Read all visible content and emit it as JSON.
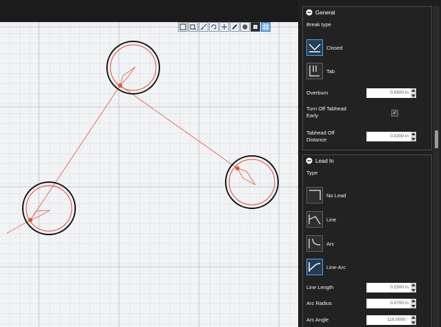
{
  "canvas": {
    "grid_color": "#cdd3d9",
    "minor_grid_color": "#e6e9ed",
    "background": "#f2f3f4",
    "path_color": "#e35a4a",
    "marker_color": "#d9572a",
    "circle_outer_color": "#111111",
    "circle_inner_color": "#e0473b",
    "toolbar_icons": [
      "zoom-fit-icon",
      "zoom-window-icon",
      "measure-icon",
      "rotate-view-icon",
      "move-view-icon",
      "draw-icon",
      "shade-icon",
      "square-icon",
      "grid-icon"
    ]
  },
  "panel": {
    "general": {
      "title": "General",
      "break_type_label": "Break type",
      "options": [
        {
          "label": "Closed",
          "icon": "closed-break-icon",
          "selected": true
        },
        {
          "label": "Tab",
          "icon": "tab-break-icon",
          "selected": false
        }
      ],
      "overburn": {
        "label": "Overburn",
        "value": "0.0500 in"
      },
      "turn_off": {
        "label_line1": "Turn Off Tabhead",
        "label_line2": "Early",
        "checked": true,
        "check_glyph": "✓"
      },
      "tabhead_off": {
        "label_line1": "Tabhead Off",
        "label_line2": "Distance",
        "value": "0.0200 in"
      }
    },
    "leadin": {
      "title": "Lead In",
      "type_label": "Type",
      "options": [
        {
          "label": "No Lead",
          "icon": "no-lead-icon",
          "selected": false
        },
        {
          "label": "Line",
          "icon": "line-lead-icon",
          "selected": false
        },
        {
          "label": "Arc",
          "icon": "arc-lead-icon",
          "selected": false
        },
        {
          "label": "Line-Arc",
          "icon": "line-arc-lead-icon",
          "selected": true
        }
      ],
      "line_length": {
        "label": "Line Length",
        "value": "0.1500 in"
      },
      "arc_radius": {
        "label": "Arc Radius",
        "value": "0.0700 in"
      },
      "arc_angle": {
        "label": "Arc Angle",
        "value": "110.0000 °"
      }
    }
  }
}
